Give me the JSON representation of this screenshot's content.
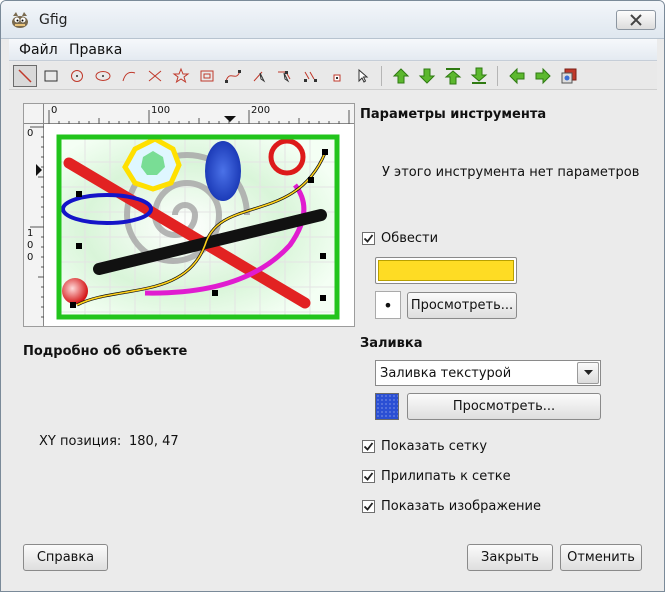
{
  "window": {
    "title": "Gfig"
  },
  "menubar": {
    "items": [
      {
        "label": "Файл"
      },
      {
        "label": "Правка"
      }
    ]
  },
  "toolbar": {
    "tools": [
      "line-tool-icon",
      "rectangle-tool-icon",
      "circle-tool-icon",
      "ellipse-tool-icon",
      "arc-tool-icon",
      "polygon-tool-icon",
      "star-tool-icon",
      "spiral-tool-icon",
      "bezier-tool-icon",
      "move-object-icon",
      "move-point-icon",
      "copy-object-icon",
      "delete-object-icon",
      "select-object-icon"
    ],
    "order": [
      "raise-icon",
      "lower-icon",
      "raise-to-top-icon",
      "lower-to-bottom-icon"
    ],
    "nav": [
      "previous-icon",
      "next-icon",
      "show-all-icon"
    ]
  },
  "preview": {
    "ruler_labels": {
      "h": [
        "0",
        "100",
        "200"
      ],
      "v": [
        "0",
        "1",
        "0",
        "0"
      ]
    }
  },
  "object_details": {
    "title": "Подробно об объекте",
    "xy_label": "XY позиция:",
    "xy_value": "180, 47"
  },
  "tool_options": {
    "title": "Параметры инструмента",
    "message": "У этого инструмента нет параметров"
  },
  "stroke": {
    "label": "Обвести",
    "checked": true,
    "color": "#fedc24",
    "brush_preview_glyph": "•",
    "browse_label": "Просмотреть..."
  },
  "fill": {
    "title": "Заливка",
    "selected": "Заливка текстурой",
    "pattern_color": "#2a4fd4",
    "browse_label": "Просмотреть..."
  },
  "options": {
    "show_grid": {
      "label": "Показать сетку",
      "checked": true
    },
    "snap_grid": {
      "label": "Прилипать к сетке",
      "checked": true
    },
    "show_image": {
      "label": "Показать изображение",
      "checked": true
    }
  },
  "buttons": {
    "help": "Справка",
    "close": "Закрыть",
    "cancel": "Отменить"
  }
}
